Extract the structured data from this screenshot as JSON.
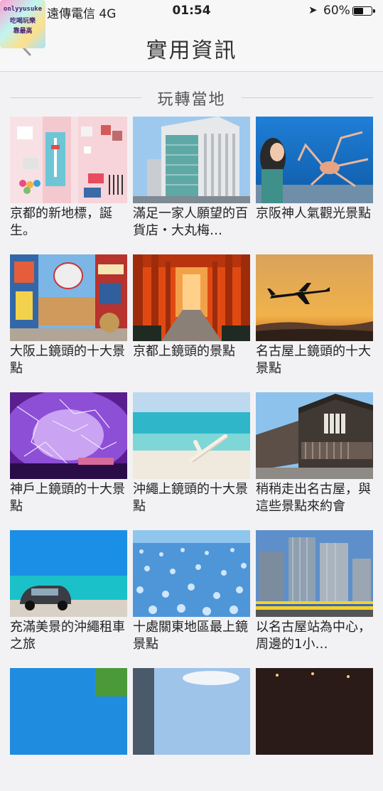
{
  "status_bar": {
    "carrier": "遠傳電信  4G",
    "time": "01:54",
    "battery": "60%",
    "battery_level": 0.6
  },
  "watermark": {
    "line1": "onlyyusuke",
    "line2": "吃喝玩樂",
    "line3": "靠最高"
  },
  "nav": {
    "title": "實用資訊"
  },
  "section": {
    "title": "玩轉當地"
  },
  "items": [
    {
      "caption": "京都的新地標，誕生。",
      "thumb": "kyoto-tower-goods"
    },
    {
      "caption": "滿足一家人願望的百貨店・大丸梅…",
      "thumb": "daimaru-umeda-building"
    },
    {
      "caption": "京阪神人氣觀光景點",
      "thumb": "aquarium-spider-crab"
    },
    {
      "caption": "大阪上鏡頭的十大景點",
      "thumb": "dotonbori-street"
    },
    {
      "caption": "京都上鏡頭的景點",
      "thumb": "fushimi-inari-torii"
    },
    {
      "caption": "名古屋上鏡頭的十大景點",
      "thumb": "airplane-sunset"
    },
    {
      "caption": "神戶上鏡頭的十大景點",
      "thumb": "purple-light-tunnel"
    },
    {
      "caption": "沖繩上鏡頭的十大景點",
      "thumb": "okinawa-beach-driftwood"
    },
    {
      "caption": "稍稍走出名古屋，與這些景點來約會",
      "thumb": "old-townhouses"
    },
    {
      "caption": "充滿美景的沖繩租車之旅",
      "thumb": "car-by-sea"
    },
    {
      "caption": "十處關東地區最上鏡景點",
      "thumb": "nemophila-field"
    },
    {
      "caption": "以名古屋站為中心，周邊的1小…",
      "thumb": "nagoya-station-towers"
    },
    {
      "caption": "",
      "thumb": "partial-blue-sky"
    },
    {
      "caption": "",
      "thumb": "partial-city-sky"
    },
    {
      "caption": "",
      "thumb": "partial-night"
    }
  ]
}
